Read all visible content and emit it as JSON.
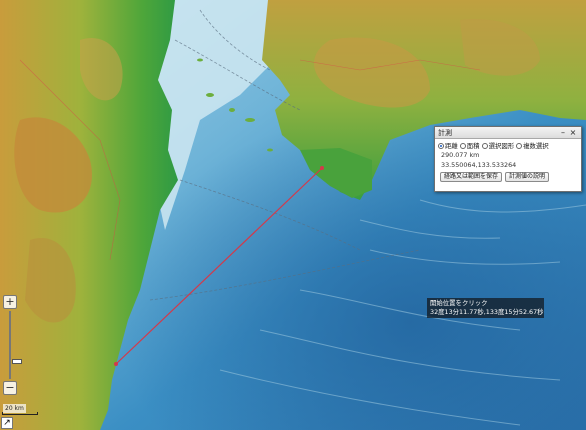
{
  "map": {
    "zoom_level": 0.62
  },
  "measure_panel": {
    "title": "計測",
    "minimize_label": "–",
    "close_label": "×",
    "modes": [
      {
        "label": "距離",
        "checked": true
      },
      {
        "label": "面積",
        "checked": false
      },
      {
        "label": "選択図形",
        "checked": false
      },
      {
        "label": "複数選択",
        "checked": false
      }
    ],
    "distance": "290.077 km",
    "coordinates": "33.550064,133.533264",
    "save_button": "経路又は範囲を保存",
    "help_button": "計測値の説明"
  },
  "tooltip": {
    "line1": "開始位置をクリック",
    "line2": "32度13分11.77秒,133度15分52.67秒"
  },
  "zoom": {
    "in_label": "+",
    "out_label": "−"
  },
  "scale": {
    "label": "20 km"
  },
  "corner_button": {
    "label": "↗"
  }
}
